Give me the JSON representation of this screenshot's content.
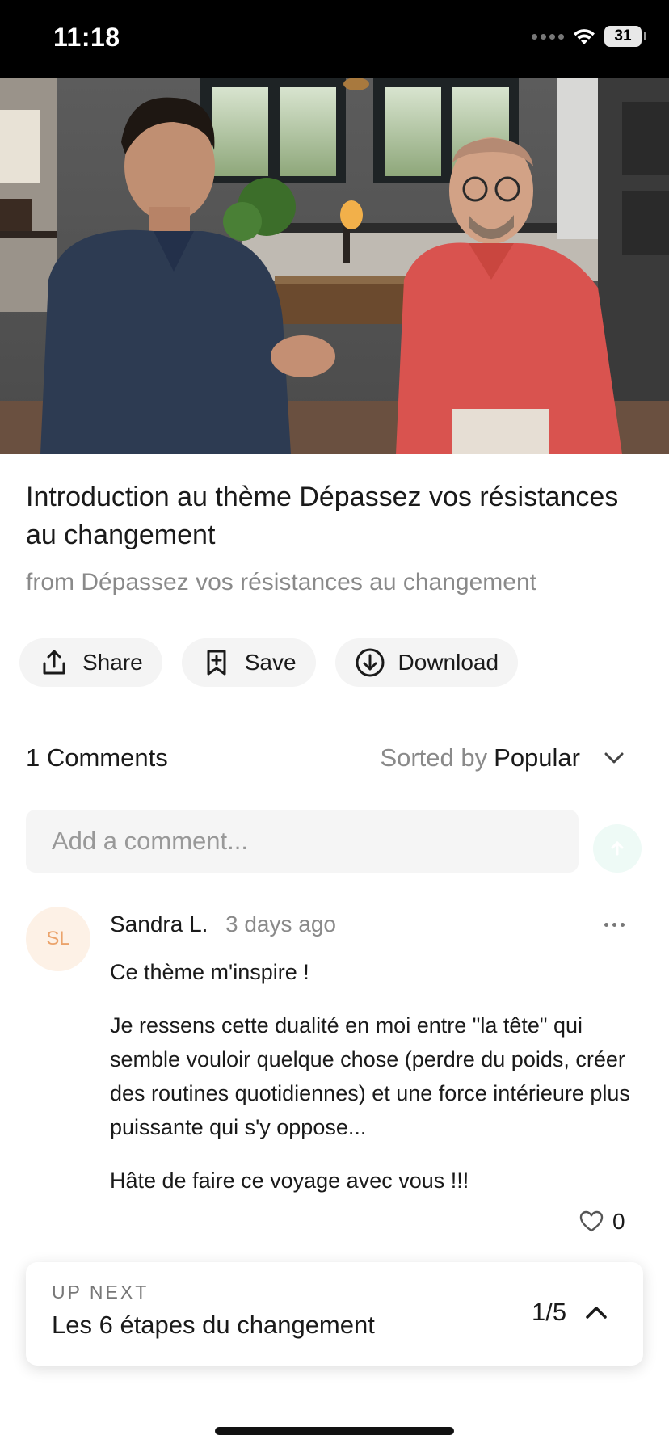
{
  "status_bar": {
    "time": "11:18",
    "battery": "31"
  },
  "lesson": {
    "title": "Introduction au thème Dépassez vos résistances au changement",
    "from": "from Dépassez vos résistances au changement"
  },
  "actions": {
    "share": "Share",
    "save": "Save",
    "download": "Download"
  },
  "comments": {
    "count_label": "1 Comments",
    "sort_prefix": "Sorted by",
    "sort_value": "Popular",
    "input_placeholder": "Add a comment...",
    "items": [
      {
        "initials": "SL",
        "author": "Sandra L.",
        "time": "3 days ago",
        "paragraphs": [
          "Ce thème m'inspire !",
          "Je ressens cette dualité en moi entre \"la tête\" qui semble vouloir quelque chose (perdre du poids, créer des routines quotidiennes) et une force intérieure plus puissante qui s'y oppose...",
          "Hâte de faire ce voyage avec vous !!!"
        ],
        "likes": "0"
      }
    ]
  },
  "up_next": {
    "label": "UP NEXT",
    "title": "Les 6 étapes du changement",
    "position": "1/5"
  },
  "colors": {
    "avatar_text": "#eba36b",
    "avatar_bg": "#fdf1e6",
    "send_bg": "#eefaf6"
  }
}
